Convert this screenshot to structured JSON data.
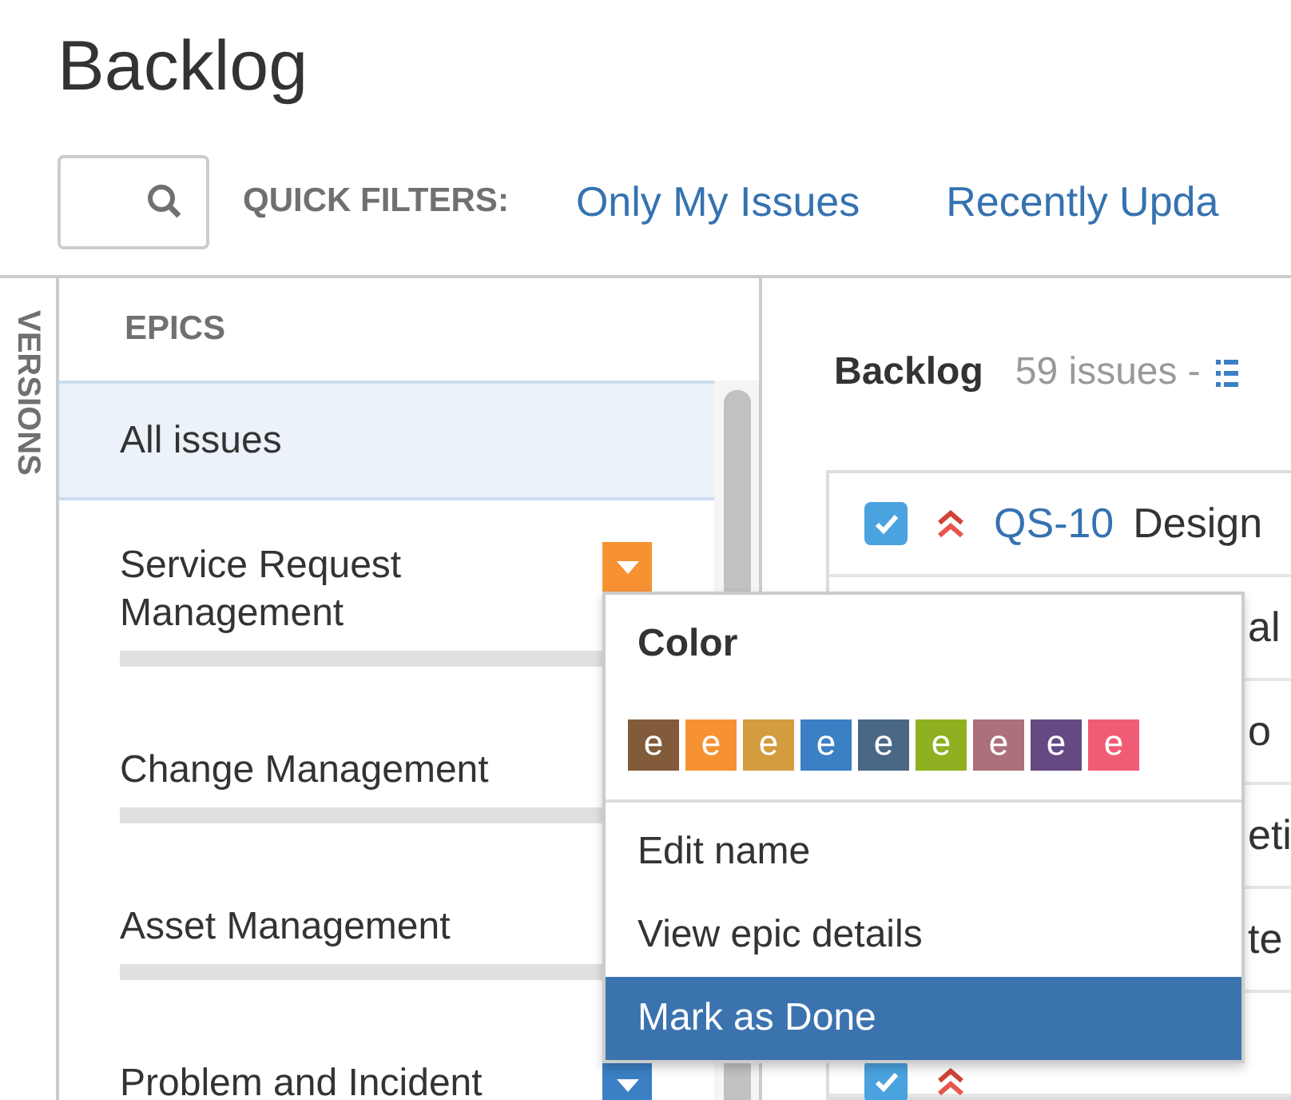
{
  "page_title": "Backlog",
  "quick_filters": {
    "label": "QUICK FILTERS:",
    "filters": [
      "Only My Issues",
      "Recently Upda"
    ]
  },
  "versions_tab": "VERSIONS",
  "epics": {
    "header": "EPICS",
    "all_issues": {
      "label": "All issues",
      "selected": true
    },
    "items": [
      {
        "name": "Service Request Management",
        "color": "#f79232"
      },
      {
        "name": "Change Management"
      },
      {
        "name": "Asset Management"
      },
      {
        "name": "Problem and Incident",
        "color": "#3b7fc4"
      }
    ]
  },
  "backlog": {
    "title": "Backlog",
    "count": "59 issues -",
    "rows": [
      {
        "checked": true,
        "key": "QS-10",
        "summary": "Design"
      },
      {
        "fragment": "al"
      },
      {
        "fragment": "o"
      },
      {
        "fragment": "eti"
      },
      {
        "fragment": "te"
      },
      {
        "checked": true
      }
    ]
  },
  "epic_menu": {
    "color_title": "Color",
    "swatches": [
      {
        "letter": "e",
        "color": "#815b3a"
      },
      {
        "letter": "e",
        "color": "#f79232"
      },
      {
        "letter": "e",
        "color": "#d39c3f"
      },
      {
        "letter": "e",
        "color": "#3b7fc4"
      },
      {
        "letter": "e",
        "color": "#4a6785"
      },
      {
        "letter": "e",
        "color": "#8eb021"
      },
      {
        "letter": "e",
        "color": "#ac707a"
      },
      {
        "letter": "e",
        "color": "#654982"
      },
      {
        "letter": "e",
        "color": "#f15c75"
      }
    ],
    "items": [
      {
        "label": "Edit name",
        "selected": false
      },
      {
        "label": "View epic details",
        "selected": false
      },
      {
        "label": "Mark as Done",
        "selected": true
      }
    ]
  }
}
